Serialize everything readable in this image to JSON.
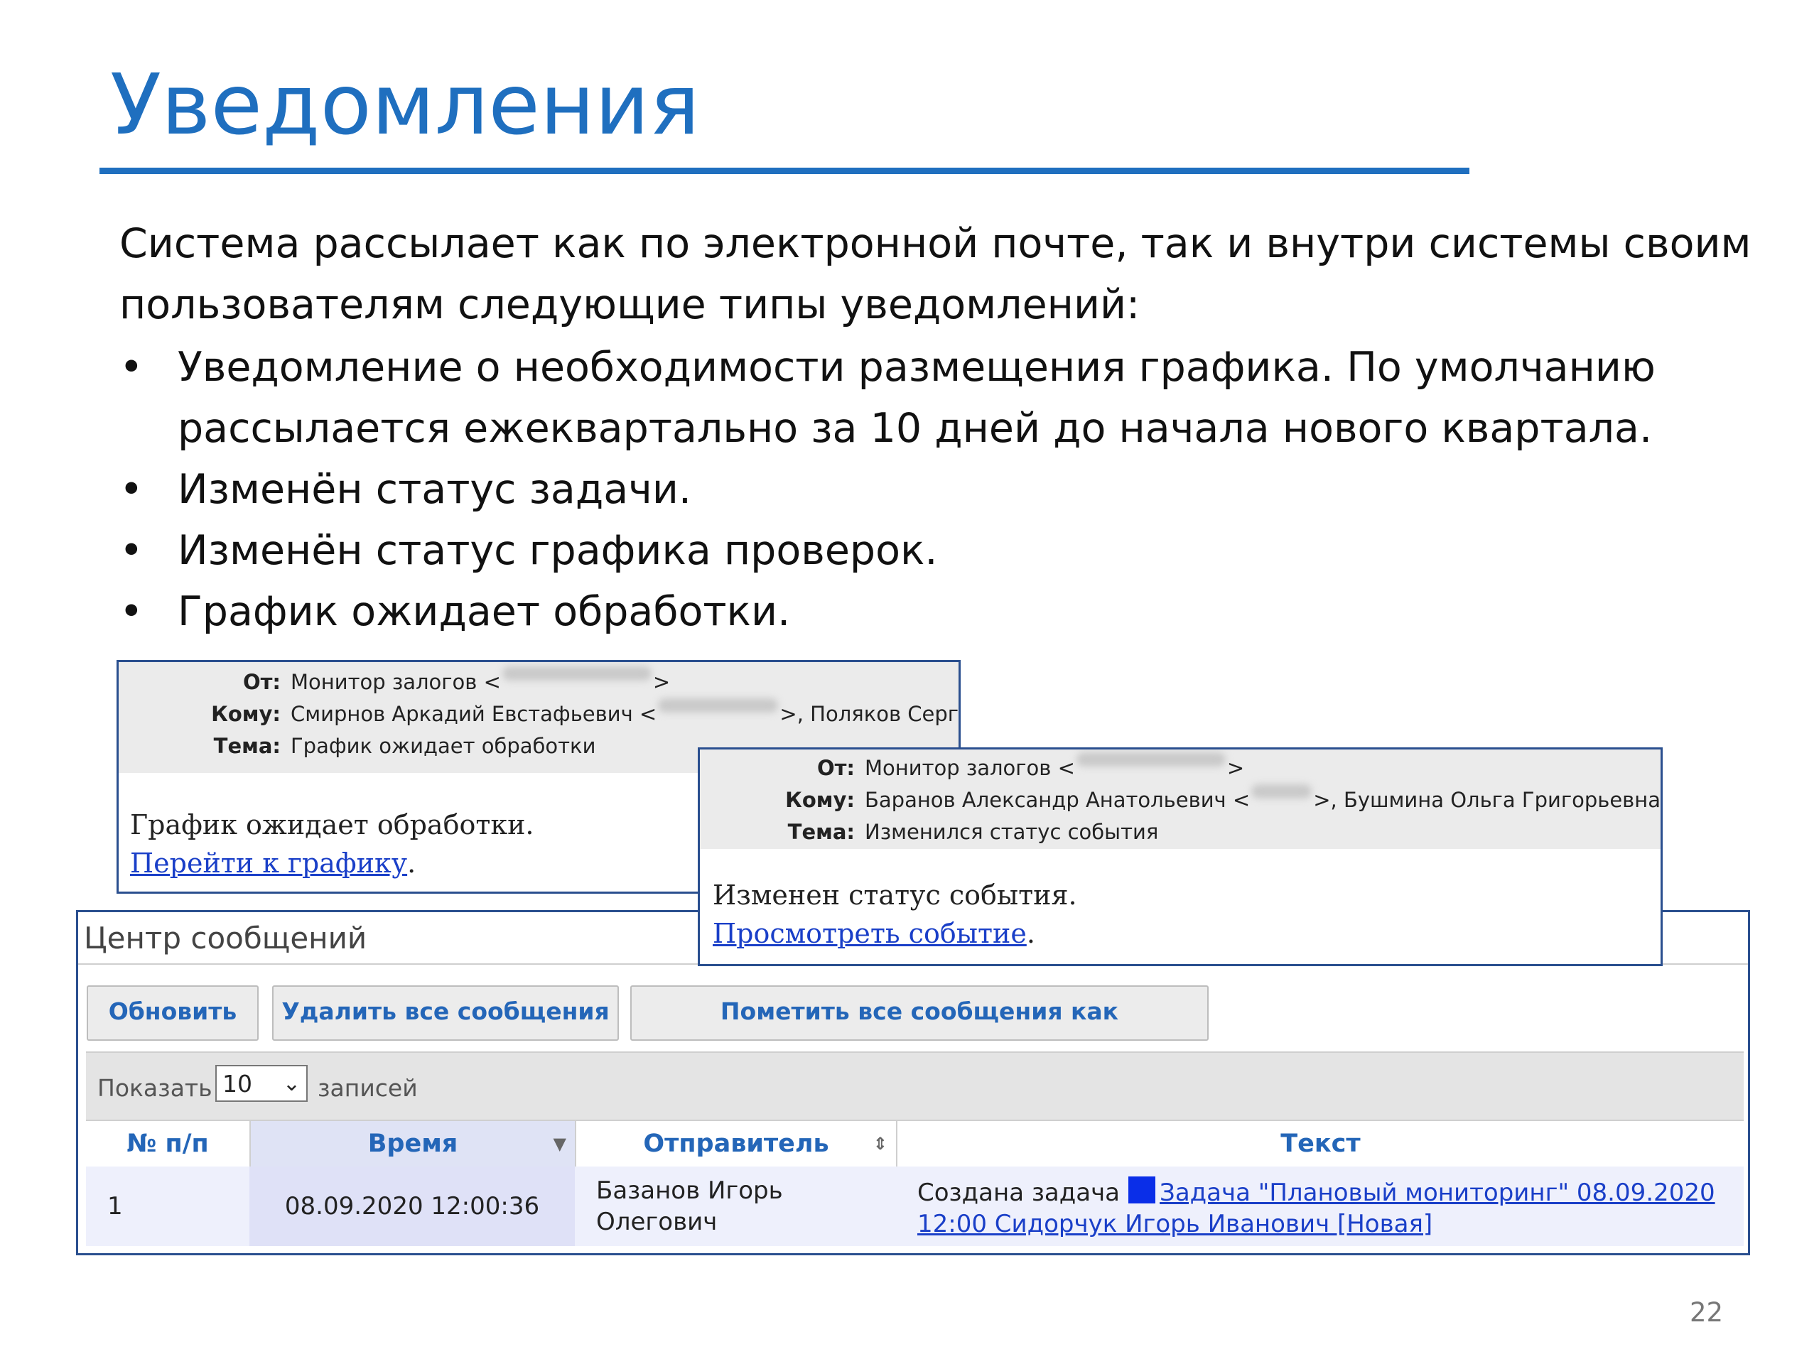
{
  "slide": {
    "title": "Уведомления",
    "intro": "Система рассылает как по электронной почте, так и внутри системы своим пользователям следующие типы уведомлений:",
    "bullets": [
      "Уведомление о необходимости размещения графика. По умолчанию рассылается ежеквартально за 10 дней до начала нового квартала.",
      "Изменён статус задачи.",
      "Изменён статус графика проверок.",
      "График ожидает обработки."
    ],
    "bullet_symbol": "•",
    "page_number": "22",
    "colors": {
      "accent": "#1F6FBF",
      "link": "#1a3fc8",
      "button_text": "#2466b8"
    }
  },
  "email1": {
    "from_label": "От:",
    "from_value": "Монитор залогов <",
    "from_value_end": ">",
    "to_label": "Кому:",
    "to_value": "Смирнов Аркадий Евстафьевич <",
    "to_value_end": ">, Поляков Серг",
    "subject_label": "Тема:",
    "subject_value": "График ожидает обработки",
    "body_text": "График ожидает обработки.",
    "body_link": "Перейти к графику",
    "body_link_suffix": "."
  },
  "email2": {
    "from_label": "От:",
    "from_value": "Монитор залогов <",
    "from_value_end": ">",
    "to_label": "Кому:",
    "to_value": "Баранов Александр Анатольевич <",
    "to_value_end": ">, Бушмина Ольга Григорьевна",
    "subject_label": "Тема:",
    "subject_value": "Изменился статус события",
    "body_text": "Изменен статус события.",
    "body_link": "Просмотреть событие",
    "body_link_suffix": "."
  },
  "message_center": {
    "title": "Центр сообщений",
    "buttons": {
      "refresh": "Обновить",
      "delete_all": "Удалить все сообщения",
      "mark_all_read": "Пометить все сообщения как прочитанные"
    },
    "show_label": "Показать",
    "page_size": "10",
    "records_label": "записей",
    "columns": {
      "num": "№ п/п",
      "time": "Время",
      "sender": "Отправитель",
      "text": "Текст"
    },
    "rows": [
      {
        "num": "1",
        "time": "08.09.2020 12:00:36",
        "sender_line1": "Базанов Игорь",
        "sender_line2": "Олегович",
        "text_prefix": "Создана задача",
        "text_link_line1": "Задача \"Плановый мониторинг\" 08.09.2020",
        "text_link_line2": "12:00 Сидорчук Игорь Иванович [Новая]"
      }
    ]
  }
}
